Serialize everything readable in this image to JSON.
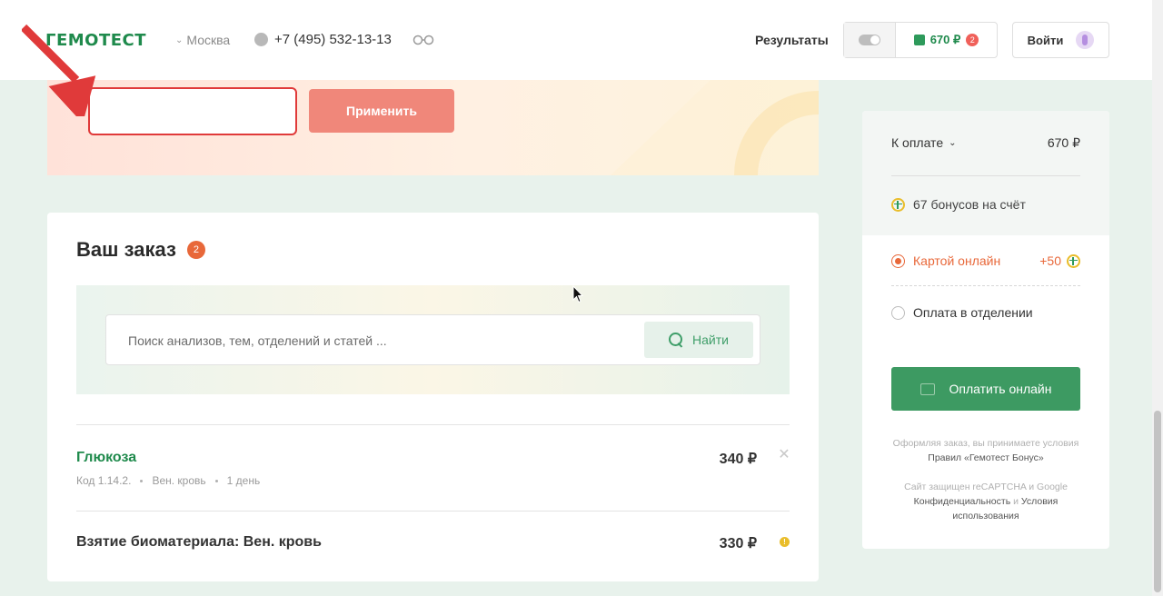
{
  "header": {
    "logo": "ГЕМОТЕСТ",
    "city": "Москва",
    "phone": "+7 (495) 532-13-13",
    "results": "Результаты",
    "cart_amount": "670 ₽",
    "cart_count": "2",
    "login": "Войти"
  },
  "promo": {
    "input_value": "",
    "apply": "Применить"
  },
  "order": {
    "title": "Ваш заказ",
    "count": "2",
    "search_placeholder": "Поиск анализов, тем, отделений и статей ...",
    "search_button": "Найти",
    "items": [
      {
        "name": "Глюкоза",
        "code": "Код 1.14.2.",
        "material": "Вен. кровь",
        "time": "1 день",
        "price": "340 ₽"
      },
      {
        "name": "Взятие биоматериала: Вен. кровь",
        "price": "330 ₽"
      }
    ]
  },
  "sidebar": {
    "to_pay_label": "К оплате",
    "to_pay_amount": "670 ₽",
    "bonus_text": "67 бонусов на счёт",
    "option_card": "Картой онлайн",
    "option_card_bonus": "+50",
    "option_office": "Оплата в отделении",
    "pay_button": "Оплатить онлайн",
    "terms_pre": "Оформляя заказ, вы принимаете условия",
    "terms_link": "Правил «Гемотест Бонус»",
    "captcha_pre": "Сайт защищен reCAPTCHA и Google",
    "privacy_link": "Конфиденциальность",
    "and": "и",
    "tos_link": "Условия использования"
  },
  "colors": {
    "brand_green": "#1f8a4c",
    "accent_orange": "#e8683a",
    "apply_button": "#f0877a",
    "pay_button": "#3d9a62",
    "annotation_red": "#e03a3a"
  },
  "icons": [
    "phone-icon",
    "glasses-icon",
    "bag-icon",
    "avatar-icon",
    "search-icon",
    "close-icon",
    "info-icon",
    "plus-circle-icon",
    "wallet-icon",
    "arrow-annotation",
    "mouse-cursor"
  ]
}
